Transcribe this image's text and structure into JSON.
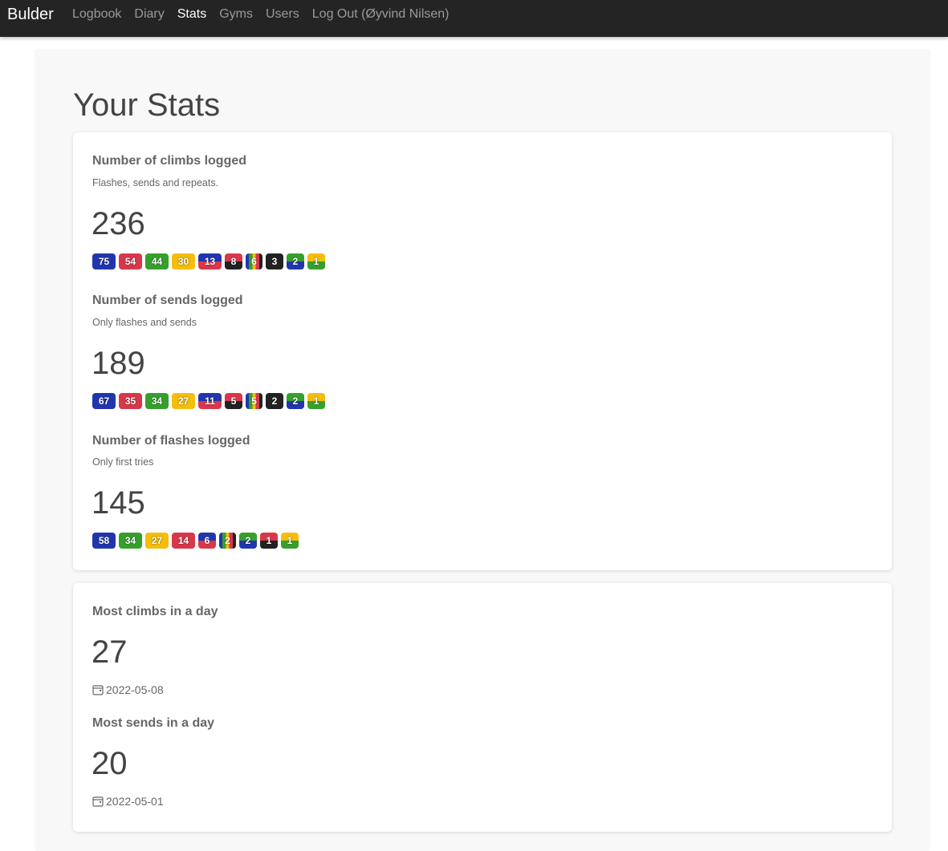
{
  "nav": {
    "brand": "Bulder",
    "links": [
      "Logbook",
      "Diary",
      "Stats",
      "Gyms",
      "Users",
      "Log Out (Øyvind Nilsen)"
    ],
    "active": "Stats"
  },
  "page": {
    "title": "Your Stats"
  },
  "colors": {
    "blue": "#2136ad",
    "red": "#d9374b",
    "green": "#36a02c",
    "yellow": "#f5bd0c",
    "black": "#222222"
  },
  "sections": [
    {
      "label": "Number of climbs logged",
      "desc": "Flashes, sends and repeats.",
      "value": "236",
      "badges": [
        {
          "count": "75",
          "color": "blue"
        },
        {
          "count": "54",
          "color": "red"
        },
        {
          "count": "44",
          "color": "green"
        },
        {
          "count": "30",
          "color": "yellow"
        },
        {
          "count": "13",
          "color": "blue-red"
        },
        {
          "count": "8",
          "color": "red-black"
        },
        {
          "count": "6",
          "color": "rainbow"
        },
        {
          "count": "3",
          "color": "black"
        },
        {
          "count": "2",
          "color": "green-blue"
        },
        {
          "count": "1",
          "color": "yellow-green"
        }
      ]
    },
    {
      "label": "Number of sends logged",
      "desc": "Only flashes and sends",
      "value": "189",
      "badges": [
        {
          "count": "67",
          "color": "blue"
        },
        {
          "count": "35",
          "color": "red"
        },
        {
          "count": "34",
          "color": "green"
        },
        {
          "count": "27",
          "color": "yellow"
        },
        {
          "count": "11",
          "color": "blue-red"
        },
        {
          "count": "5",
          "color": "red-black"
        },
        {
          "count": "5",
          "color": "rainbow"
        },
        {
          "count": "2",
          "color": "black"
        },
        {
          "count": "2",
          "color": "green-blue"
        },
        {
          "count": "1",
          "color": "yellow-green"
        }
      ]
    },
    {
      "label": "Number of flashes logged",
      "desc": "Only first tries",
      "value": "145",
      "badges": [
        {
          "count": "58",
          "color": "blue"
        },
        {
          "count": "34",
          "color": "green"
        },
        {
          "count": "27",
          "color": "yellow"
        },
        {
          "count": "14",
          "color": "red"
        },
        {
          "count": "6",
          "color": "blue-red"
        },
        {
          "count": "2",
          "color": "rainbow"
        },
        {
          "count": "2",
          "color": "green-blue"
        },
        {
          "count": "1",
          "color": "red-black"
        },
        {
          "count": "1",
          "color": "yellow-green"
        }
      ]
    }
  ],
  "records": [
    {
      "label": "Most climbs in a day",
      "value": "27",
      "date": "2022-05-08",
      "icon": "calendar-icon"
    },
    {
      "label": "Most sends in a day",
      "value": "20",
      "date": "2022-05-01",
      "icon": "calendar-icon"
    }
  ]
}
